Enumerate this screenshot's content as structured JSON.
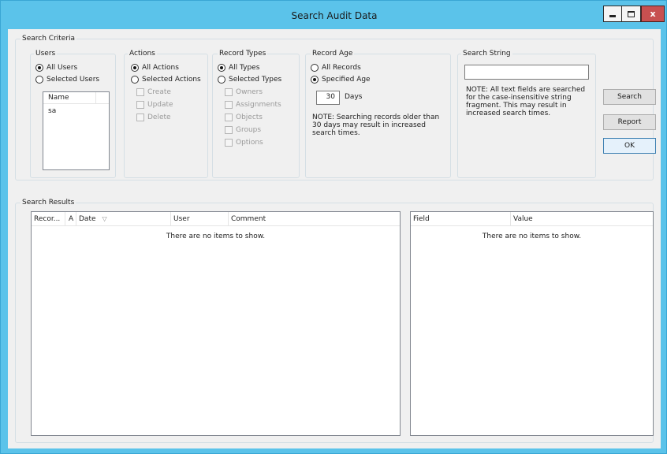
{
  "window": {
    "title": "Search Audit Data",
    "buttons": {
      "minimize": "minimize",
      "maximize": "maximize",
      "close": "x"
    },
    "colors": {
      "titlebar": "#5bc3ea",
      "close": "#c75050",
      "client": "#f0f0f0"
    }
  },
  "search_criteria": {
    "title": "Search Criteria",
    "users": {
      "title": "Users",
      "options": [
        "All Users",
        "Selected Users"
      ],
      "selected": "All Users",
      "list": {
        "header": "Name",
        "items": [
          "sa"
        ]
      }
    },
    "actions": {
      "title": "Actions",
      "options": [
        "All Actions",
        "Selected Actions"
      ],
      "selected": "All Actions",
      "checkboxes": [
        "Create",
        "Update",
        "Delete"
      ]
    },
    "record_types": {
      "title": "Record Types",
      "options": [
        "All Types",
        "Selected Types"
      ],
      "selected": "All Types",
      "checkboxes": [
        "Owners",
        "Assignments",
        "Objects",
        "Groups",
        "Options"
      ]
    },
    "record_age": {
      "title": "Record Age",
      "options": [
        "All Records",
        "Specified Age"
      ],
      "selected": "Specified Age",
      "days_value": "30",
      "days_label": "Days",
      "note": "NOTE: Searching records older than 30 days may result in increased search times."
    },
    "search_string": {
      "title": "Search String",
      "value": "",
      "note": "NOTE: All text fields are searched for the case-insensitive string fragment.  This may result in increased search times."
    }
  },
  "buttons": {
    "search": "Search",
    "report": "Report",
    "ok": "OK"
  },
  "search_results": {
    "title": "Search Results",
    "left_columns": [
      "Recor...",
      "A",
      "Date",
      "User",
      "Comment"
    ],
    "right_columns": [
      "Field",
      "Value"
    ],
    "empty_message": "There are no items to show."
  }
}
